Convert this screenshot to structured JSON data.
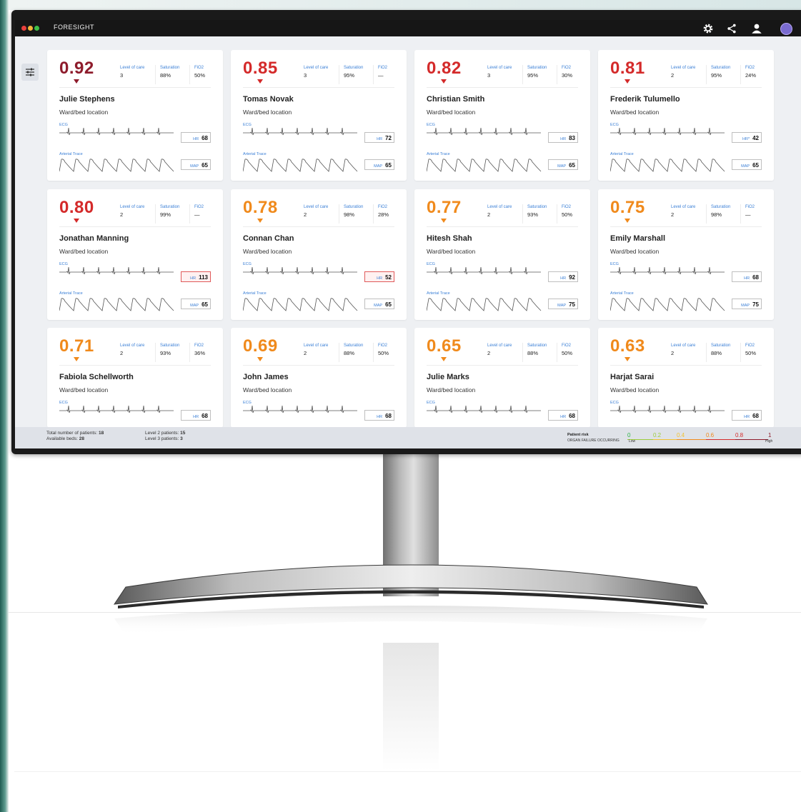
{
  "app": {
    "title": "FORESIGHT",
    "toolbar_icons": [
      "gear-icon",
      "share-icon",
      "user-icon",
      "avatar"
    ]
  },
  "sidebar": {
    "filter_icon": "sliders-icon"
  },
  "labels": {
    "level_of_care": "Level of care",
    "saturation": "Saturation",
    "fio2": "FiO2",
    "ecg": "ECG",
    "arterial_trace": "Arterial Trace",
    "hr": "HR",
    "map": "MAP",
    "location": "Ward/bed location"
  },
  "colors": {
    "risk_high": "#8e1c2c",
    "risk_red": "#d42a2a",
    "risk_orange": "#f08a1c",
    "accent_blue": "#3a7fd6",
    "alert_red": "#e05a5a"
  },
  "patients": [
    {
      "score": "0.92",
      "risk": "high",
      "level": "3",
      "saturation": "88%",
      "fio2": "50%",
      "name": "Julie Stephens",
      "hr": "68",
      "hr_alert": false,
      "map": "65"
    },
    {
      "score": "0.85",
      "risk": "red",
      "level": "3",
      "saturation": "95%",
      "fio2": "—",
      "name": "Tomas Novak",
      "hr": "72",
      "hr_alert": false,
      "map": "65"
    },
    {
      "score": "0.82",
      "risk": "red",
      "level": "3",
      "saturation": "95%",
      "fio2": "30%",
      "name": "Christian Smith",
      "hr": "83",
      "hr_alert": false,
      "map": "65"
    },
    {
      "score": "0.81",
      "risk": "red",
      "level": "2",
      "saturation": "95%",
      "fio2": "24%",
      "name": "Frederik Tulumello",
      "hr": "42",
      "hr_alert": false,
      "map": "65",
      "hr_label": "HR*"
    },
    {
      "score": "0.80",
      "risk": "red",
      "level": "2",
      "saturation": "99%",
      "fio2": "—",
      "name": "Jonathan Manning",
      "hr": "113",
      "hr_alert": true,
      "map": "65"
    },
    {
      "score": "0.78",
      "risk": "orange",
      "level": "2",
      "saturation": "98%",
      "fio2": "28%",
      "name": "Connan Chan",
      "hr": "52",
      "hr_alert": true,
      "map": "65"
    },
    {
      "score": "0.77",
      "risk": "orange",
      "level": "2",
      "saturation": "93%",
      "fio2": "50%",
      "name": "Hitesh Shah",
      "hr": "92",
      "hr_alert": false,
      "map": "75"
    },
    {
      "score": "0.75",
      "risk": "orange",
      "level": "2",
      "saturation": "98%",
      "fio2": "—",
      "name": "Emily Marshall",
      "hr": "68",
      "hr_alert": false,
      "map": "75"
    },
    {
      "score": "0.71",
      "risk": "orange",
      "level": "2",
      "saturation": "93%",
      "fio2": "36%",
      "name": "Fabiola  Schellworth",
      "hr": "68",
      "hr_alert": false,
      "map": ""
    },
    {
      "score": "0.69",
      "risk": "orange",
      "level": "2",
      "saturation": "88%",
      "fio2": "50%",
      "name": "John James",
      "hr": "68",
      "hr_alert": false,
      "map": ""
    },
    {
      "score": "0.65",
      "risk": "orange",
      "level": "2",
      "saturation": "88%",
      "fio2": "50%",
      "name": "Julie Marks",
      "hr": "68",
      "hr_alert": false,
      "map": ""
    },
    {
      "score": "0.63",
      "risk": "orange",
      "level": "2",
      "saturation": "88%",
      "fio2": "50%",
      "name": "Harjat Sarai",
      "hr": "68",
      "hr_alert": false,
      "map": ""
    }
  ],
  "footer": {
    "total_label": "Total number of patients:",
    "total": "18",
    "beds_label": "Available beds:",
    "beds": "28",
    "level2_label": "Level 2 patients:",
    "level2": "15",
    "level3_label": "Level 3 patients:",
    "level3": "3",
    "risk_title": "Patient risk",
    "risk_sub": "ORGAN FAILURE OCCURRING",
    "scale": [
      {
        "value": "0",
        "color": "#2db34a"
      },
      {
        "value": "0.2",
        "color": "#9ccc3c"
      },
      {
        "value": "0.4",
        "color": "#f2c232"
      },
      {
        "value": "0.6",
        "color": "#f08a1c"
      },
      {
        "value": "0.8",
        "color": "#d42a2a"
      },
      {
        "value": "1",
        "color": "#8e1c2c"
      }
    ],
    "scale_low": "Low",
    "scale_high": "High"
  }
}
